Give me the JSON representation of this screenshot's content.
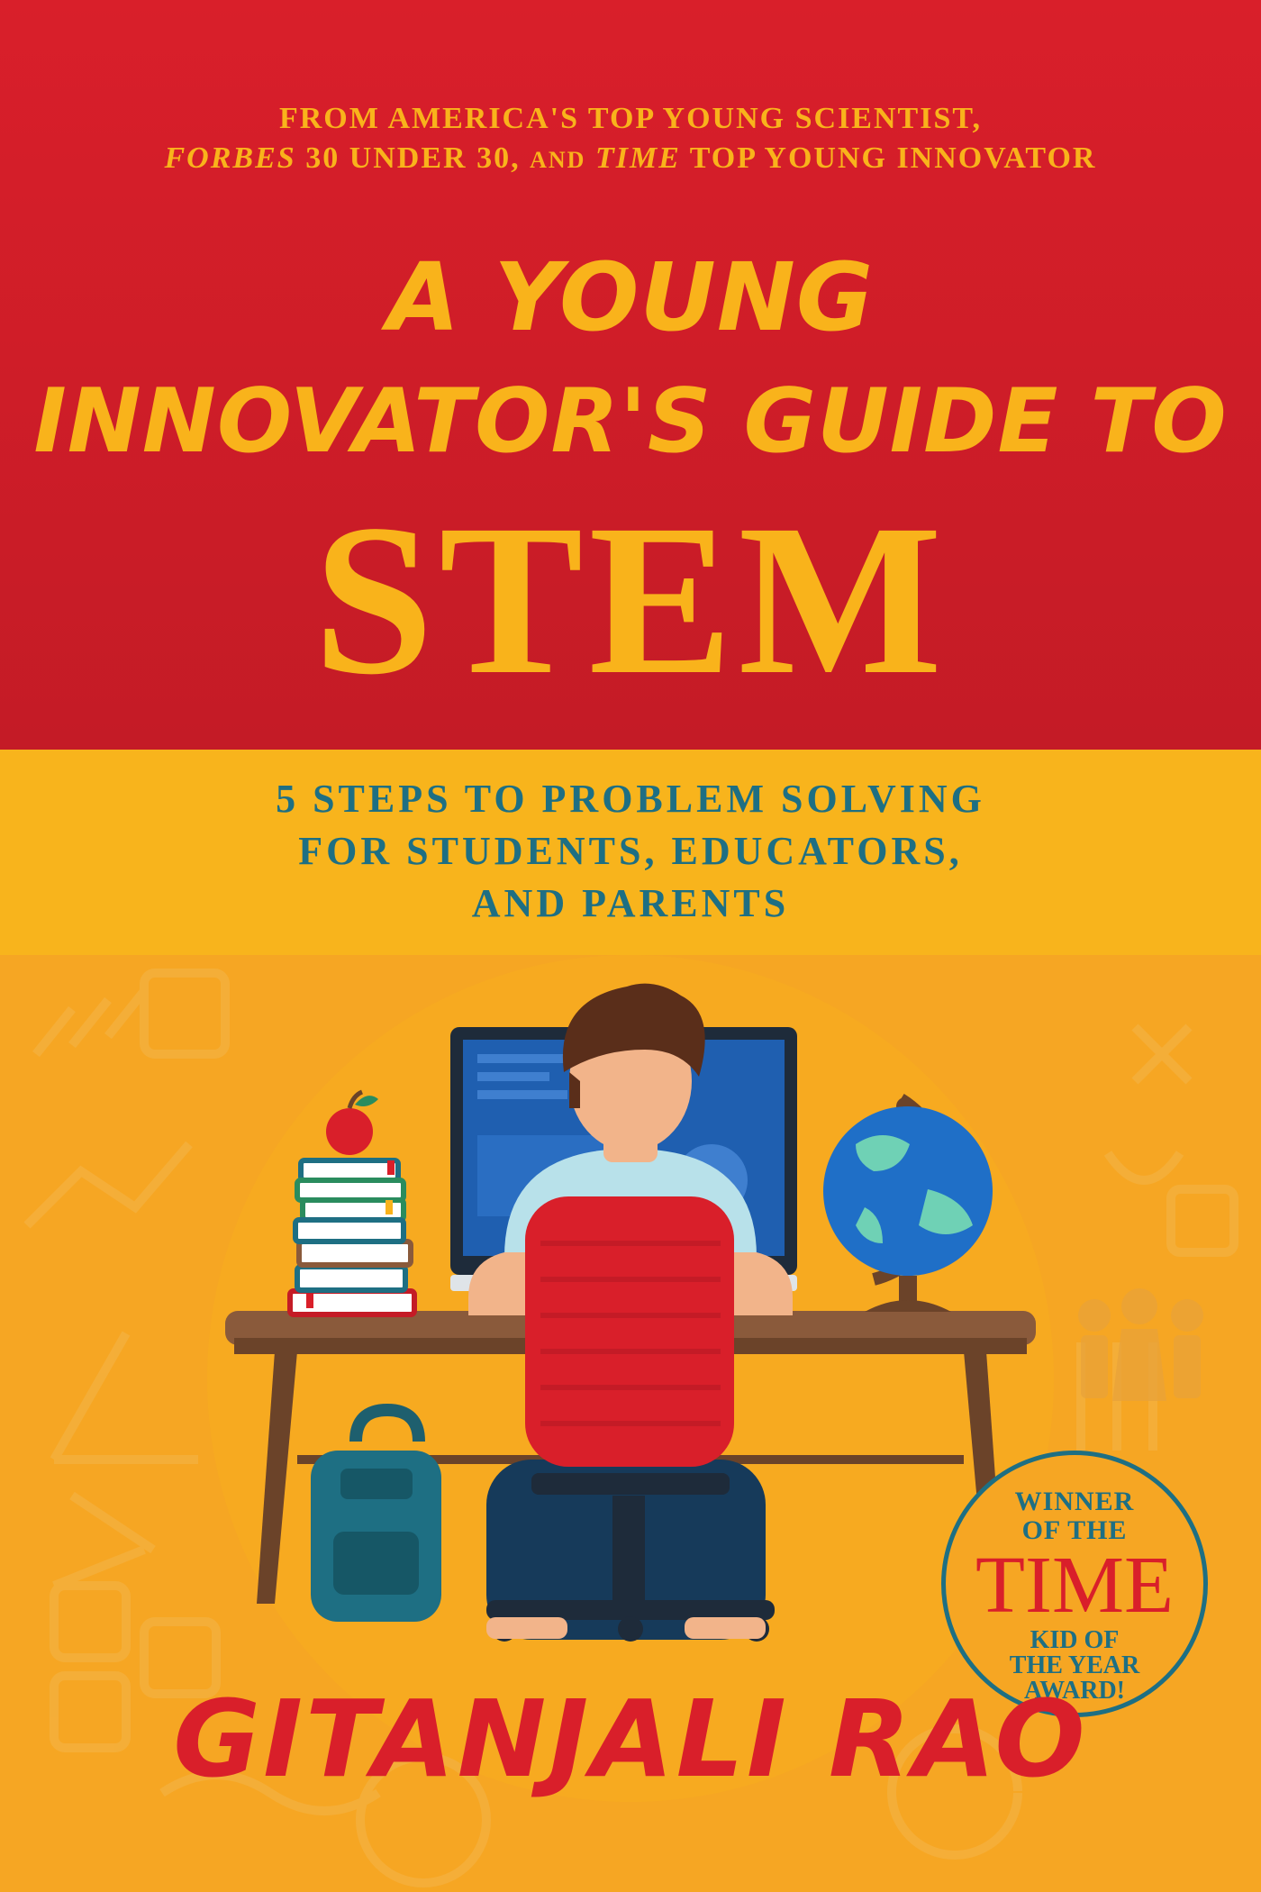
{
  "cover": {
    "endorsement": {
      "line1": "FROM AMERICA'S TOP YOUNG SCIENTIST,",
      "forbes": "FORBES",
      "mid1": " 30 UNDER 30, ",
      "and": "AND",
      "time": "TIME",
      "mid2": " TOP YOUNG INNOVATOR"
    },
    "title": {
      "line1": "A YOUNG",
      "line2": "INNOVATOR'S GUIDE TO",
      "line3": "STEM"
    },
    "subtitle": {
      "line1": "5 STEPS TO PROBLEM SOLVING",
      "line2": "FOR STUDENTS, EDUCATORS,",
      "line3": "AND PARENTS"
    },
    "badge": {
      "line1": "WINNER",
      "line2": "OF THE",
      "time": "TIME",
      "line3": "KID OF",
      "line4": "THE YEAR",
      "line5": "AWARD!"
    },
    "author": "GITANJALI RAO"
  },
  "colors": {
    "red": "#d91f2a",
    "gold": "#f9b31b",
    "orange": "#f6a623",
    "teal": "#1e6f83"
  },
  "illustration": {
    "icons": [
      "student-at-desk",
      "computer-monitor",
      "red-chair",
      "book-stack-icon",
      "apple-icon",
      "globe-icon",
      "backpack-icon"
    ]
  }
}
